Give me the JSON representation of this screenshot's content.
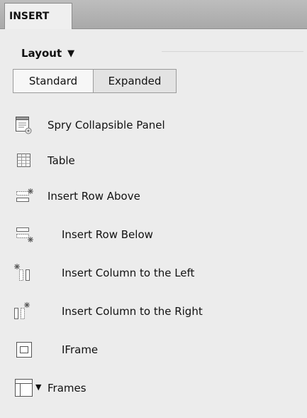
{
  "panel": {
    "tab_label": "INSERT"
  },
  "category": {
    "label": "Layout"
  },
  "view_toggle": {
    "standard": "Standard",
    "expanded": "Expanded",
    "selected": "Standard"
  },
  "items": [
    {
      "label": "Spry Collapsible Panel",
      "icon": "spry-collapsible-panel-icon"
    },
    {
      "label": "Table",
      "icon": "table-icon"
    },
    {
      "label": "Insert Row Above",
      "icon": "insert-row-above-icon"
    },
    {
      "label": "Insert Row Below",
      "icon": "insert-row-below-icon"
    },
    {
      "label": "Insert Column to the Left",
      "icon": "insert-column-left-icon"
    },
    {
      "label": "Insert Column to the Right",
      "icon": "insert-column-right-icon"
    },
    {
      "label": "IFrame",
      "icon": "iframe-icon"
    },
    {
      "label": "Frames",
      "icon": "frames-icon"
    }
  ]
}
